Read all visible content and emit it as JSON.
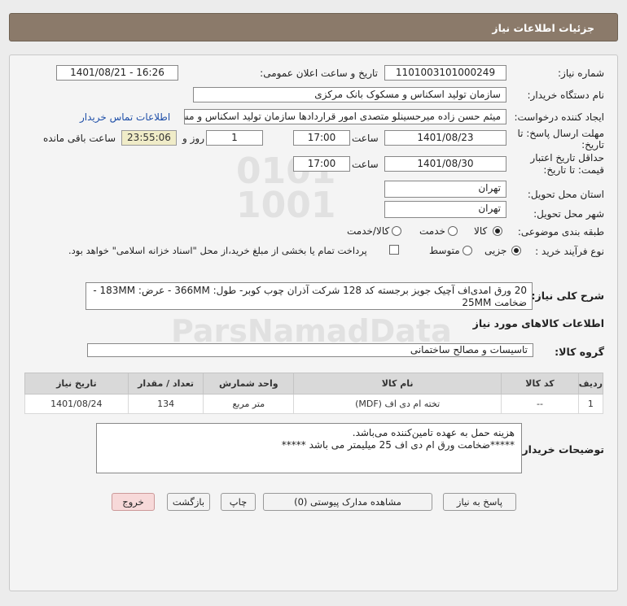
{
  "header": {
    "title": "جزئیات اطلاعات نیاز"
  },
  "form": {
    "need_number_label": "شماره نیاز:",
    "need_number": "1101003101000249",
    "announce_label": "تاریخ و ساعت اعلان عمومی:",
    "announce_value": "1401/08/21 - 16:26",
    "buyer_org_label": "نام دستگاه خریدار:",
    "buyer_org": "سازمان تولید اسکناس و مسکوک بانک مرکزی",
    "requester_label": "ایجاد کننده درخواست:",
    "requester": "میثم حسن زاده میرحسینلو متصدی امور قراردادها سازمان تولید اسکناس و مسکوک بانک مرکزی",
    "buyer_contact_link": "اطلاعات تماس خریدار",
    "deadline_label_1": "مهلت ارسال پاسخ: تا",
    "deadline_label_2": "تاریخ:",
    "deadline_date": "1401/08/23",
    "time_label": "ساعت",
    "deadline_time": "17:00",
    "days_value": "1",
    "days_label": "روز و",
    "remaining_time": "23:55:06",
    "remaining_label": "ساعت باقی مانده",
    "validity_label_1": "حداقل تاریخ اعتبار",
    "validity_label_2": "قیمت: تا تاریخ:",
    "validity_date": "1401/08/30",
    "validity_time": "17:00",
    "province_label": "استان محل تحویل:",
    "province": "تهران",
    "city_label": "شهر محل تحویل:",
    "city": "تهران",
    "category_label": "طبقه بندی موضوعی:",
    "category_options": [
      "کالا",
      "خدمت",
      "کالا/خدمت"
    ],
    "category_selected": "کالا",
    "purchase_type_label": "نوع فرآیند خرید :",
    "purchase_options": [
      "جزیی",
      "متوسط"
    ],
    "purchase_selected": "جزیی",
    "payment_note": "پرداخت تمام یا بخشی از مبلغ خرید،از محل \"اسناد خزانه اسلامی\" خواهد بود.",
    "summary_label": "شرح کلی نیاز:",
    "summary_text": "20 ورق امدی‌اف آچیک جویز برجسته کد 128 شرکت آذران چوب کوبر-  طول: 366MM - عرض: 183MM - ضخامت 25MM",
    "goods_info_title": "اطلاعات کالاهای مورد نیاز",
    "goods_group_label": "گروه کالا:",
    "goods_group": "تاسیسات و مصالح ساختمانی"
  },
  "table": {
    "headers": [
      "ردیف",
      "کد کالا",
      "نام کالا",
      "واحد شمارش",
      "تعداد / مقدار",
      "تاریخ نیاز"
    ],
    "rows": [
      [
        "1",
        "--",
        "تخته ام دی اف (MDF)",
        "متر مربع",
        "134",
        "1401/08/24"
      ]
    ]
  },
  "buyer_notes": {
    "label": "توضیحات خریدار:",
    "line1": "هزینه حمل به عهده تامین‌کننده می‌باشد.",
    "line2": "*****ضخامت ورق ام دی اف 25 میلیمتر می باشد *****"
  },
  "buttons": {
    "reply": "پاسخ به نیاز",
    "view_docs": "مشاهده مدارک پیوستی (0)",
    "print": "چاپ",
    "back": "بازگشت",
    "exit": "خروج"
  }
}
